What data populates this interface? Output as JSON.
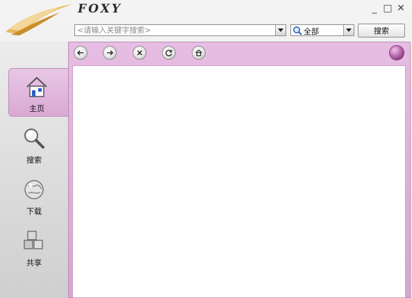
{
  "app": {
    "brand": "FOXY",
    "window_controls": {
      "minimize": "_",
      "maximize": "□",
      "close": "✕"
    }
  },
  "search": {
    "placeholder": "<请输入关键字搜索>",
    "scope_selected": "全部",
    "button_label": "搜索"
  },
  "sidebar": {
    "items": [
      {
        "label": "主页",
        "icon": "home-icon",
        "active": true
      },
      {
        "label": "搜索",
        "icon": "magnifier-icon",
        "active": false
      },
      {
        "label": "下载",
        "icon": "globe-download-icon",
        "active": false
      },
      {
        "label": "共享",
        "icon": "share-cubes-icon",
        "active": false
      }
    ]
  },
  "toolbar": {
    "buttons": [
      "back-icon",
      "forward-icon",
      "stop-icon",
      "refresh-icon",
      "home-icon"
    ],
    "globe_icon": "globe-icon"
  },
  "colors": {
    "accent_pink": "#d9a9d4",
    "frame_border": "#b88fb3",
    "logo_gold": "#d8a23a"
  }
}
